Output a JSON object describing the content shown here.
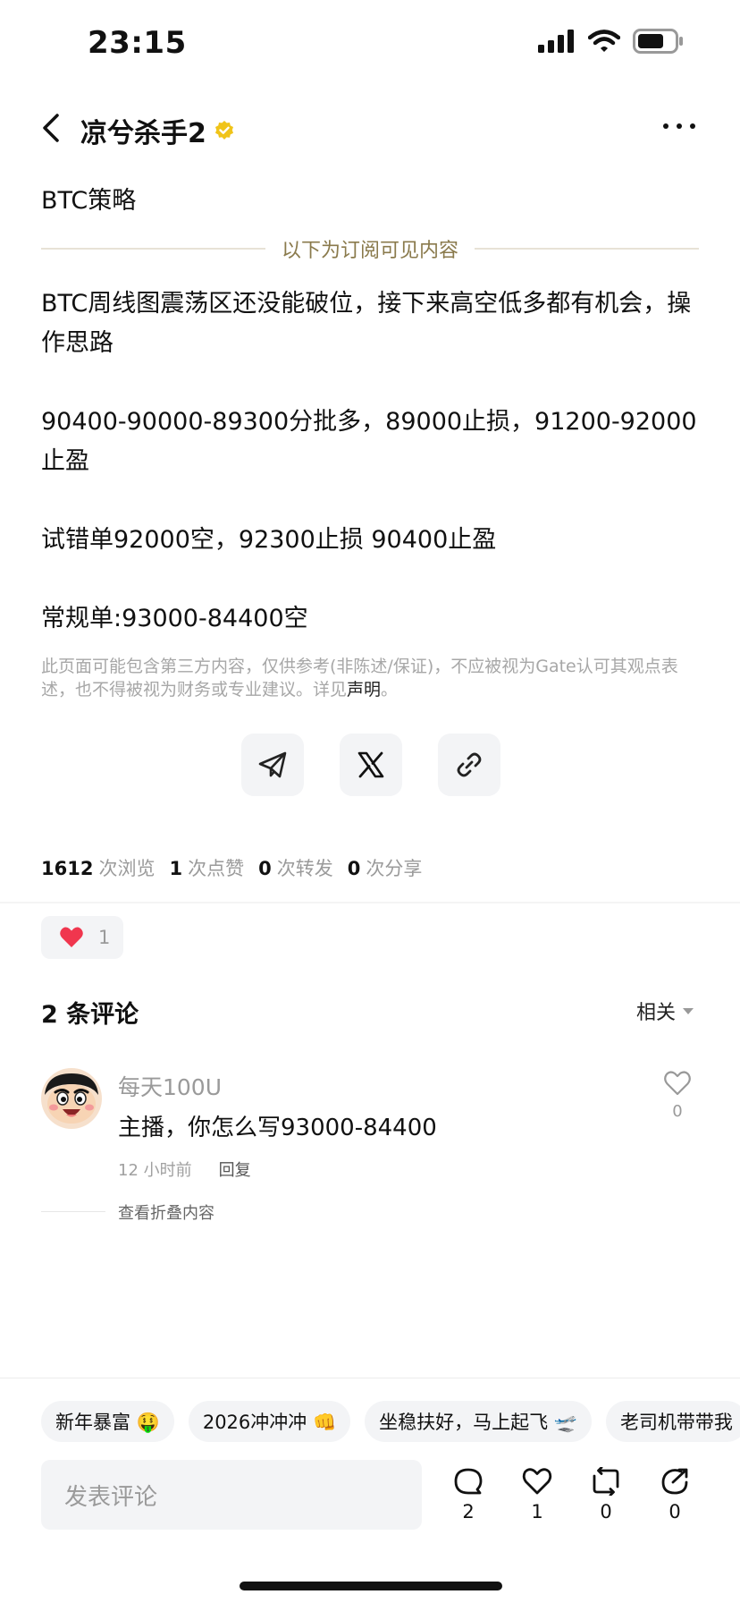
{
  "status_bar": {
    "time": "23:15"
  },
  "header": {
    "author": "凉兮杀手2"
  },
  "post": {
    "title": "BTC策略",
    "subscribe_divider": "以下为订阅可见内容",
    "paragraphs": [
      "BTC周线图震荡区还没能破位，接下来高空低多都有机会，操作思路",
      "90400-90000-89300分批多，89000止损，91200-92000止盈",
      "试错单92000空，92300止损 90400止盈",
      "常规单:93000-84400空"
    ],
    "disclaimer": "此页面可能包含第三方内容，仅供参考(非陈述/保证)，不应被视为Gate认可其观点表述，也不得被视为财务或专业建议。详见",
    "disclaimer_link": "声明",
    "disclaimer_end": "。"
  },
  "stats": [
    {
      "value": "1612",
      "label": "次浏览"
    },
    {
      "value": "1",
      "label": "次点赞"
    },
    {
      "value": "0",
      "label": "次转发"
    },
    {
      "value": "0",
      "label": "次分享"
    }
  ],
  "like_pill": {
    "count": "1"
  },
  "comments": {
    "title": "2 条评论",
    "sort_label": "相关",
    "items": [
      {
        "user": "每天100U",
        "text": "主播，你怎么写93000-84400",
        "time": "12 小时前",
        "reply_label": "回复",
        "likes": "0"
      }
    ],
    "fold_text": "查看折叠内容"
  },
  "chips": [
    "新年暴富 🤑",
    "2026冲冲冲 👊",
    "坐稳扶好，马上起飞 🛫",
    "老司机带带我"
  ],
  "composer": {
    "placeholder": "发表评论",
    "actions": [
      {
        "icon": "comment-icon",
        "count": "2"
      },
      {
        "icon": "heart-icon",
        "count": "1"
      },
      {
        "icon": "repost-icon",
        "count": "0"
      },
      {
        "icon": "share-icon",
        "count": "0"
      }
    ]
  }
}
